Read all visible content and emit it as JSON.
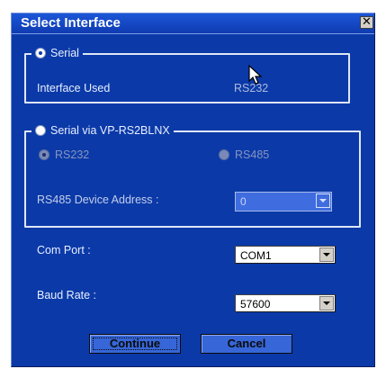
{
  "dialog": {
    "title": "Select Interface",
    "close_symbol": "✕"
  },
  "serial_group": {
    "option_label": "Serial",
    "option_selected": true,
    "interface_used_label": "Interface Used",
    "interface_used_value": "RS232"
  },
  "vp_group": {
    "option_label": "Serial via VP-RS2BLNX",
    "option_selected": false,
    "rs232_label": "RS232",
    "rs485_label": "RS485",
    "address_label": "RS485 Device Address :",
    "address_value": "0"
  },
  "com_port": {
    "label": "Com Port :",
    "value": "COM1"
  },
  "baud_rate": {
    "label": "Baud Rate :",
    "value": "57600"
  },
  "buttons": {
    "continue_label": "Continue",
    "cancel_label": "Cancel"
  },
  "colors": {
    "dialog_bg": "#0b3aa8",
    "button_bg": "#3666d8"
  }
}
